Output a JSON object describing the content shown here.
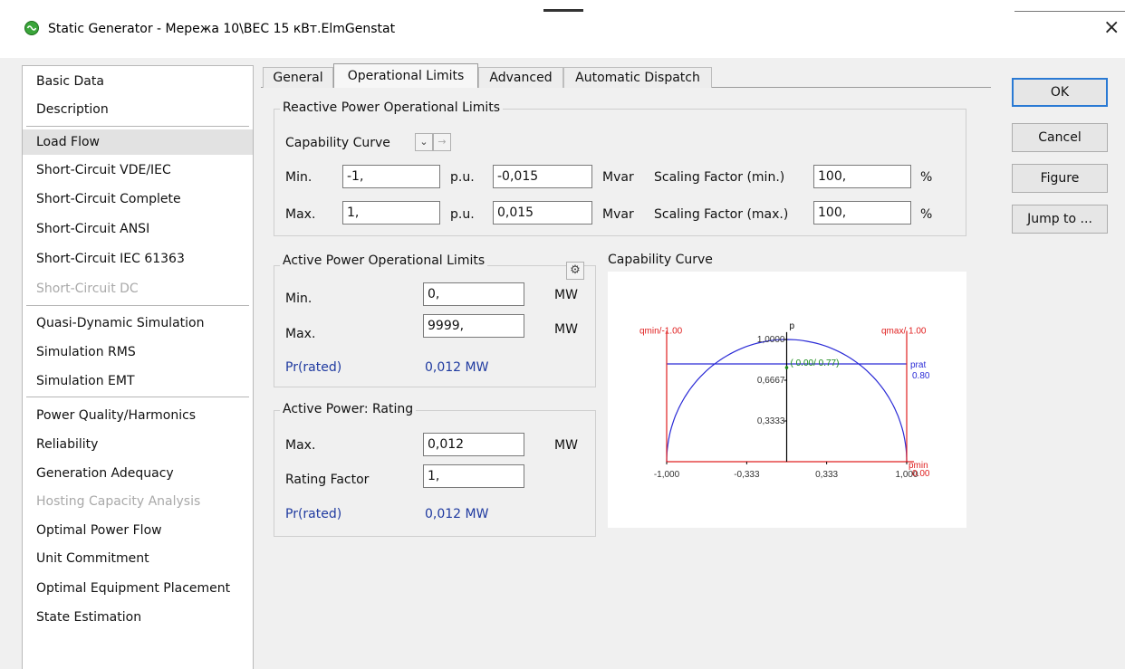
{
  "window": {
    "title": "Static Generator - Мережа 10\\ВЕС 15 кВт.ElmGenstat",
    "close_glyph": "×",
    "app_icon": "generator-icon"
  },
  "sidebar": {
    "items": [
      {
        "label": "Basic Data",
        "state": "normal"
      },
      {
        "label": "Description",
        "state": "normal"
      },
      {
        "label": "Load Flow",
        "state": "selected"
      },
      {
        "label": "Short-Circuit VDE/IEC",
        "state": "normal"
      },
      {
        "label": "Short-Circuit Complete",
        "state": "normal"
      },
      {
        "label": "Short-Circuit ANSI",
        "state": "normal"
      },
      {
        "label": "Short-Circuit IEC 61363",
        "state": "normal"
      },
      {
        "label": "Short-Circuit DC",
        "state": "disabled"
      },
      {
        "label": "Quasi-Dynamic Simulation",
        "state": "normal"
      },
      {
        "label": "Simulation RMS",
        "state": "normal"
      },
      {
        "label": "Simulation EMT",
        "state": "normal"
      },
      {
        "label": "Power Quality/Harmonics",
        "state": "normal"
      },
      {
        "label": "Reliability",
        "state": "normal"
      },
      {
        "label": "Generation Adequacy",
        "state": "normal"
      },
      {
        "label": "Hosting Capacity Analysis",
        "state": "disabled"
      },
      {
        "label": "Optimal Power Flow",
        "state": "normal"
      },
      {
        "label": "Unit Commitment",
        "state": "normal"
      },
      {
        "label": "Optimal Equipment Placement",
        "state": "normal"
      },
      {
        "label": "State Estimation",
        "state": "normal"
      }
    ]
  },
  "tabs": [
    {
      "label": "General"
    },
    {
      "label": "Operational Limits",
      "active": true
    },
    {
      "label": "Advanced"
    },
    {
      "label": "Automatic Dispatch"
    }
  ],
  "reactive": {
    "title": "Reactive Power Operational Limits",
    "capability_label": "Capability Curve",
    "dropdown_glyph": "⌄",
    "arrow_glyph": "→",
    "min_label": "Min.",
    "max_label": "Max.",
    "min_pu": "-1,",
    "max_pu": "1,",
    "pu_unit": "p.u.",
    "min_mvar": "-0,015",
    "max_mvar": "0,015",
    "mvar_unit": "Mvar",
    "scale_min_label": "Scaling Factor (min.)",
    "scale_max_label": "Scaling Factor (max.)",
    "scale_min": "100,",
    "scale_max": "100,",
    "percent_unit": "%"
  },
  "active_limits": {
    "title": "Active Power Operational Limits",
    "settings_icon": "gear-icon",
    "min_label": "Min.",
    "max_label": "Max.",
    "min_value": "0,",
    "max_value": "9999,",
    "unit": "MW",
    "pr_label": "Pr(rated)",
    "pr_value": "0,012 MW"
  },
  "active_rating": {
    "title": "Active Power: Rating",
    "max_label": "Max.",
    "max_value": "0,012",
    "unit": "MW",
    "factor_label": "Rating Factor",
    "factor_value": "1,",
    "pr_label": "Pr(rated)",
    "pr_value": "0,012 MW"
  },
  "buttons": {
    "ok": "OK",
    "cancel": "Cancel",
    "figure": "Figure",
    "jump": "Jump to ..."
  },
  "chart_data": {
    "type": "line",
    "title": "Capability Curve",
    "xlim": [
      -1.0,
      1.0
    ],
    "ylim": [
      0,
      1.0
    ],
    "x_ticks": [
      {
        "value": -1.0,
        "label": "-1,000"
      },
      {
        "value": -0.333,
        "label": "-0,333"
      },
      {
        "value": 0.333,
        "label": "0,333"
      },
      {
        "value": 1.0,
        "label": "1,000"
      }
    ],
    "y_ticks": [
      {
        "value": 1.0,
        "label": "1,0000"
      },
      {
        "value": 0.6667,
        "label": "0,6667"
      },
      {
        "value": 0.3333,
        "label": "0,3333"
      }
    ],
    "y_axis_label": "p",
    "curve": {
      "type": "semicircle",
      "radius": 1.0
    },
    "qmin": {
      "value": -1.0,
      "label": "qmin/-1.00"
    },
    "qmax": {
      "value": 1.0,
      "label": "qmax/ 1.00"
    },
    "prat": {
      "value": 0.8,
      "label": "prat",
      "value_label": "0.80"
    },
    "pmin": {
      "value": 0.0,
      "label": "pmin",
      "value_label": "0.00"
    },
    "operating_point": {
      "q": 0.0,
      "p": 0.77,
      "label": "( 0.00/ 0.77)"
    },
    "colors": {
      "curve": "#2b2bd6",
      "limits": "#e02020",
      "axis": "#000000",
      "point": "#1a8a1a"
    }
  }
}
